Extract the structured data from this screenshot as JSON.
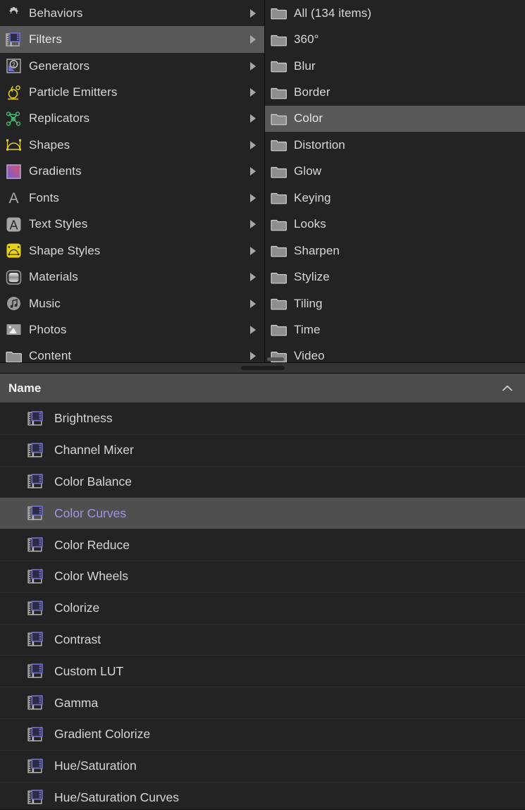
{
  "library": {
    "categories": {
      "panel_name": "library-categories",
      "items": [
        {
          "label": "Behaviors",
          "icon": "gear-icon",
          "selected": false,
          "has_disclosure": true
        },
        {
          "label": "Filters",
          "icon": "filter-film-icon",
          "selected": true,
          "has_disclosure": true
        },
        {
          "label": "Generators",
          "icon": "generator-icon",
          "selected": false,
          "has_disclosure": true
        },
        {
          "label": "Particle Emitters",
          "icon": "particle-emitter-icon",
          "selected": false,
          "has_disclosure": true
        },
        {
          "label": "Replicators",
          "icon": "replicator-icon",
          "selected": false,
          "has_disclosure": true
        },
        {
          "label": "Shapes",
          "icon": "shape-icon",
          "selected": false,
          "has_disclosure": true
        },
        {
          "label": "Gradients",
          "icon": "gradient-icon",
          "selected": false,
          "has_disclosure": true
        },
        {
          "label": "Fonts",
          "icon": "font-icon",
          "selected": false,
          "has_disclosure": true
        },
        {
          "label": "Text Styles",
          "icon": "text-style-icon",
          "selected": false,
          "has_disclosure": true
        },
        {
          "label": "Shape Styles",
          "icon": "shape-style-icon",
          "selected": false,
          "has_disclosure": true
        },
        {
          "label": "Materials",
          "icon": "material-icon",
          "selected": false,
          "has_disclosure": true
        },
        {
          "label": "Music",
          "icon": "music-icon",
          "selected": false,
          "has_disclosure": true
        },
        {
          "label": "Photos",
          "icon": "photo-icon",
          "selected": false,
          "has_disclosure": true
        },
        {
          "label": "Content",
          "icon": "folder-icon",
          "selected": false,
          "has_disclosure": true
        }
      ]
    },
    "subcategories": {
      "panel_name": "filter-subcategories",
      "items": [
        {
          "label": "All (134 items)",
          "icon": "folder-icon",
          "selected": false
        },
        {
          "label": "360°",
          "icon": "folder-icon",
          "selected": false
        },
        {
          "label": "Blur",
          "icon": "folder-icon",
          "selected": false
        },
        {
          "label": "Border",
          "icon": "folder-icon",
          "selected": false
        },
        {
          "label": "Color",
          "icon": "folder-icon",
          "selected": true
        },
        {
          "label": "Distortion",
          "icon": "folder-icon",
          "selected": false
        },
        {
          "label": "Glow",
          "icon": "folder-icon",
          "selected": false
        },
        {
          "label": "Keying",
          "icon": "folder-icon",
          "selected": false
        },
        {
          "label": "Looks",
          "icon": "folder-icon",
          "selected": false
        },
        {
          "label": "Sharpen",
          "icon": "folder-icon",
          "selected": false
        },
        {
          "label": "Stylize",
          "icon": "folder-icon",
          "selected": false
        },
        {
          "label": "Tiling",
          "icon": "folder-icon",
          "selected": false
        },
        {
          "label": "Time",
          "icon": "folder-icon",
          "selected": false
        },
        {
          "label": "Video",
          "icon": "folder-icon",
          "selected": false
        }
      ]
    }
  },
  "list_header": {
    "column_label": "Name",
    "sort_icon": "chevron-up-icon",
    "sort_direction": "ascending"
  },
  "filter_list": {
    "panel_name": "filter-results-list",
    "items": [
      {
        "label": "Brightness",
        "icon": "filter-film-icon",
        "selected": false
      },
      {
        "label": "Channel Mixer",
        "icon": "filter-film-icon",
        "selected": false
      },
      {
        "label": "Color Balance",
        "icon": "filter-film-icon",
        "selected": false
      },
      {
        "label": "Color Curves",
        "icon": "filter-film-icon",
        "selected": true
      },
      {
        "label": "Color Reduce",
        "icon": "filter-film-icon",
        "selected": false
      },
      {
        "label": "Color Wheels",
        "icon": "filter-film-icon",
        "selected": false
      },
      {
        "label": "Colorize",
        "icon": "filter-film-icon",
        "selected": false
      },
      {
        "label": "Contrast",
        "icon": "filter-film-icon",
        "selected": false
      },
      {
        "label": "Custom LUT",
        "icon": "filter-film-icon",
        "selected": false
      },
      {
        "label": "Gamma",
        "icon": "filter-film-icon",
        "selected": false
      },
      {
        "label": "Gradient Colorize",
        "icon": "filter-film-icon",
        "selected": false
      },
      {
        "label": "Hue/Saturation",
        "icon": "filter-film-icon",
        "selected": false
      },
      {
        "label": "Hue/Saturation Curves",
        "icon": "filter-film-icon",
        "selected": false
      }
    ]
  },
  "divider": {
    "name": "panel-resize-handle"
  },
  "colors": {
    "background": "#232323",
    "selection": "#595959",
    "list_selection": "#4f4f4f",
    "selected_text_accent": "#9c96e8",
    "header_background": "#4c4c4c",
    "text": "#d6d6d6",
    "filter_icon_accent": "#6f6fd0",
    "yellow_accent": "#e8d11a",
    "green_accent": "#3fbf6f"
  }
}
